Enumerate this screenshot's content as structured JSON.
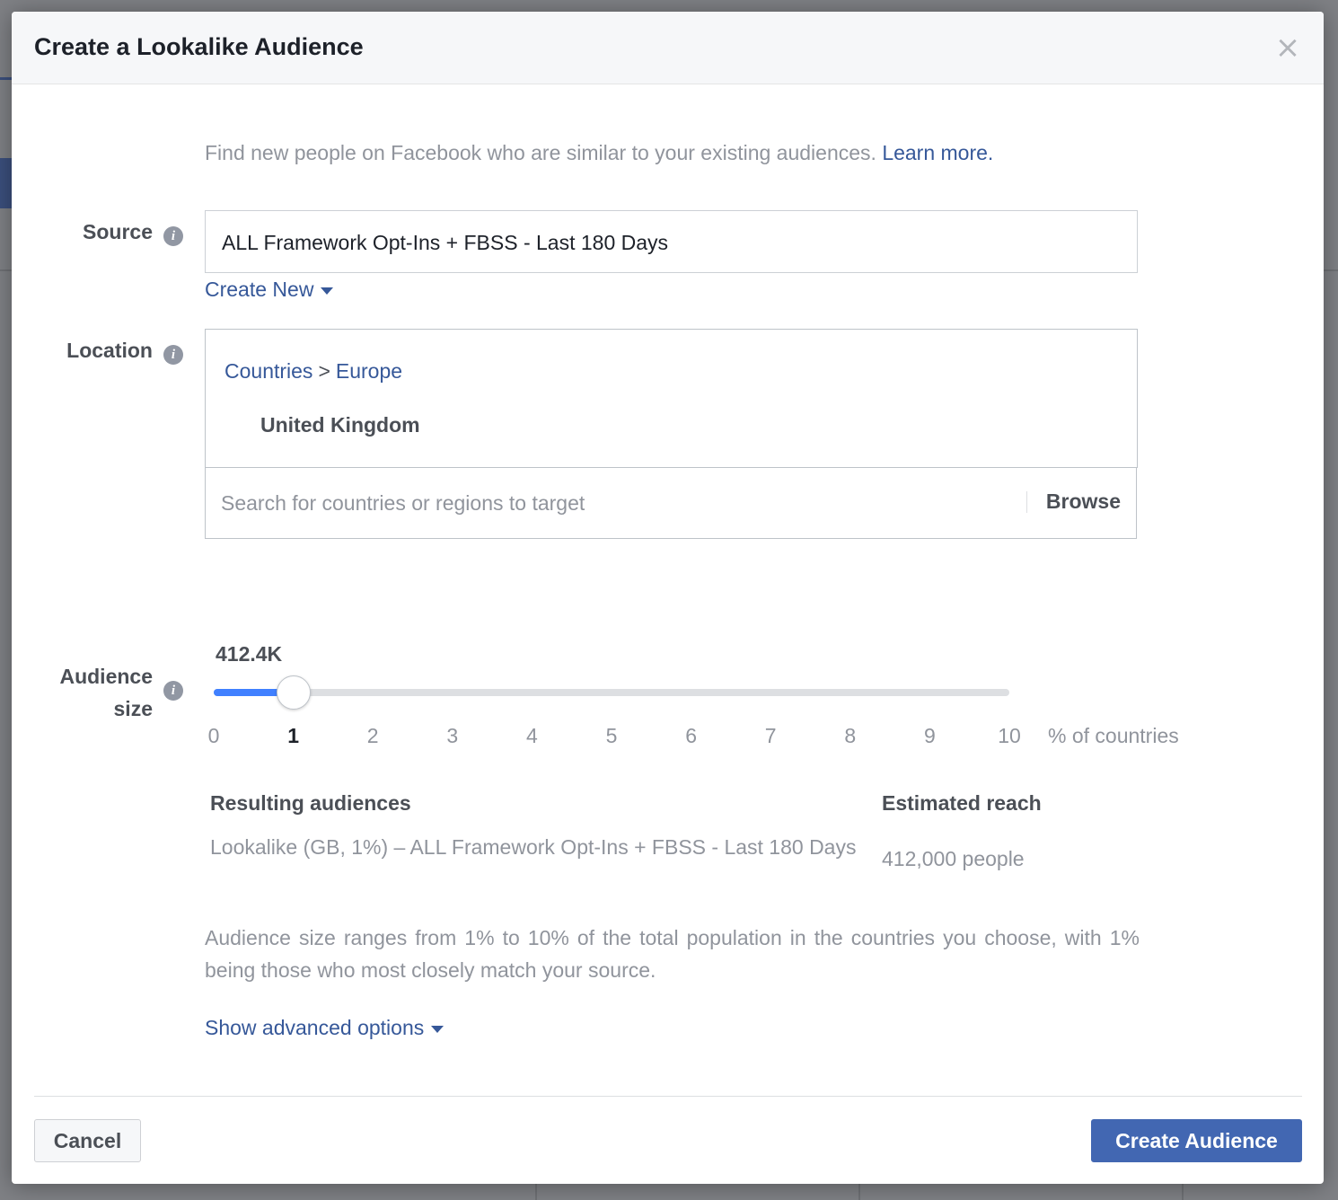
{
  "modal": {
    "title": "Create a Lookalike Audience",
    "close_symbol": "×"
  },
  "intro": {
    "text": "Find new people on Facebook who are similar to your existing audiences.",
    "link": "Learn more."
  },
  "source": {
    "label": "Source",
    "value": "ALL Framework Opt-Ins + FBSS - Last 180 Days",
    "create_new": "Create New"
  },
  "location": {
    "label": "Location",
    "breadcrumb": [
      "Countries",
      ">",
      "Europe"
    ],
    "selected_country": "United Kingdom",
    "search_placeholder": "Search for countries or regions to target",
    "browse": "Browse"
  },
  "audience_size": {
    "label_line1": "Audience",
    "label_line2": "size",
    "value": "412.4K",
    "selected_percent": 1,
    "slider_min": 0,
    "slider_max": 10,
    "ticks": [
      "0",
      "1",
      "2",
      "3",
      "4",
      "5",
      "6",
      "7",
      "8",
      "9",
      "10"
    ],
    "unit_label": "% of countries"
  },
  "results": {
    "audiences_header": "Resulting audiences",
    "reach_header": "Estimated reach",
    "audience_name": "Lookalike (GB, 1%) – ALL Framework Opt-Ins + FBSS - Last 180 Days",
    "reach_value": "412,000 people"
  },
  "note": "Audience size ranges from 1% to 10% of the total population in the countries you choose, with 1% being those who most closely match your source.",
  "advanced_link": "Show advanced options",
  "footer": {
    "cancel": "Cancel",
    "create": "Create Audience"
  },
  "colors": {
    "accent": "#4267b2",
    "link": "#365899",
    "slider_fill": "#4080ff"
  }
}
